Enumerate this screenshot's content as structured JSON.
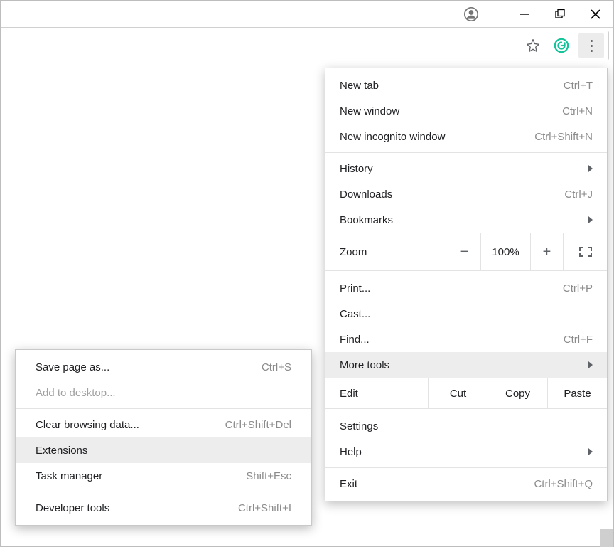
{
  "menu": {
    "new_tab": {
      "label": "New tab",
      "shortcut": "Ctrl+T"
    },
    "new_window": {
      "label": "New window",
      "shortcut": "Ctrl+N"
    },
    "new_incognito": {
      "label": "New incognito window",
      "shortcut": "Ctrl+Shift+N"
    },
    "history": {
      "label": "History"
    },
    "downloads": {
      "label": "Downloads",
      "shortcut": "Ctrl+J"
    },
    "bookmarks": {
      "label": "Bookmarks"
    },
    "zoom": {
      "label": "Zoom",
      "minus": "−",
      "value": "100%",
      "plus": "+"
    },
    "print": {
      "label": "Print...",
      "shortcut": "Ctrl+P"
    },
    "cast": {
      "label": "Cast..."
    },
    "find": {
      "label": "Find...",
      "shortcut": "Ctrl+F"
    },
    "more_tools": {
      "label": "More tools"
    },
    "edit": {
      "label": "Edit",
      "cut": "Cut",
      "copy": "Copy",
      "paste": "Paste"
    },
    "settings": {
      "label": "Settings"
    },
    "help": {
      "label": "Help"
    },
    "exit": {
      "label": "Exit",
      "shortcut": "Ctrl+Shift+Q"
    }
  },
  "submenu": {
    "save_page": {
      "label": "Save page as...",
      "shortcut": "Ctrl+S"
    },
    "add_desktop": {
      "label": "Add to desktop..."
    },
    "clear_browsing": {
      "label": "Clear browsing data...",
      "shortcut": "Ctrl+Shift+Del"
    },
    "extensions": {
      "label": "Extensions"
    },
    "task_manager": {
      "label": "Task manager",
      "shortcut": "Shift+Esc"
    },
    "dev_tools": {
      "label": "Developer tools",
      "shortcut": "Ctrl+Shift+I"
    }
  }
}
